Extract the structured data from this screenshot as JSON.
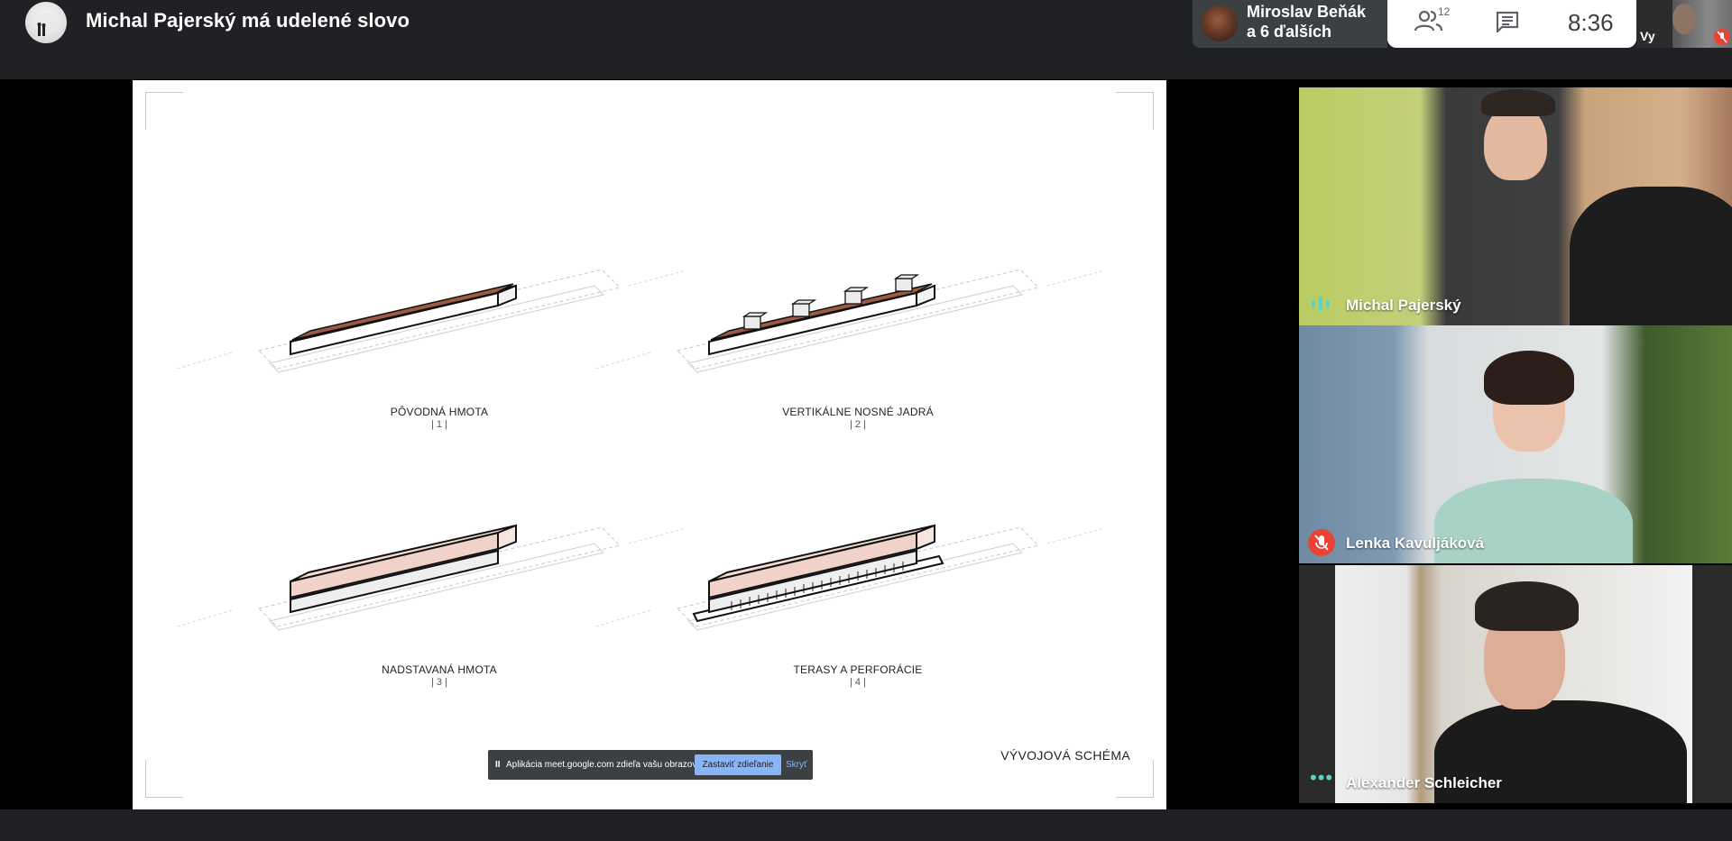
{
  "header": {
    "meeting_title": "Michal Pajerský má udelené slovo",
    "active_speaker_line1": "Miroslav Beňák",
    "active_speaker_line2": "a 6 ďalších",
    "participants_count": "12",
    "clock": "8:36",
    "self_label": "Vy"
  },
  "slide": {
    "caption": "VÝVOJOVÁ SCHÉMA",
    "diagrams": [
      {
        "label": "PÔVODNÁ HMOTA",
        "num": "| 1 |"
      },
      {
        "label": "VERTIKÁLNE NOSNÉ JADRÁ",
        "num": "| 2 |"
      },
      {
        "label": "NADSTAVANÁ HMOTA",
        "num": "| 3 |"
      },
      {
        "label": "TERASY A PERFORÁCIE",
        "num": "| 4 |"
      }
    ]
  },
  "share_bar": {
    "pause": "II",
    "text": "Aplikácia meet.google.com zdieľa vašu obrazovku.",
    "stop_label": "Zastaviť zdieľanie",
    "hide_label": "Skryť"
  },
  "participants": [
    {
      "name": "Michal Pajerský",
      "status": "speaking"
    },
    {
      "name": "Lenka Kavuljáková",
      "status": "muted"
    },
    {
      "name": "Alexander Schleicher",
      "status": "more"
    }
  ],
  "colors": {
    "bar_bg": "#202124",
    "accent_blue": "#8ab4f8",
    "mute_red": "#ea4335",
    "speaking_teal": "#5bd3c4",
    "roof_brown": "#9a5a44",
    "mass_pink": "#f0d2c8"
  }
}
